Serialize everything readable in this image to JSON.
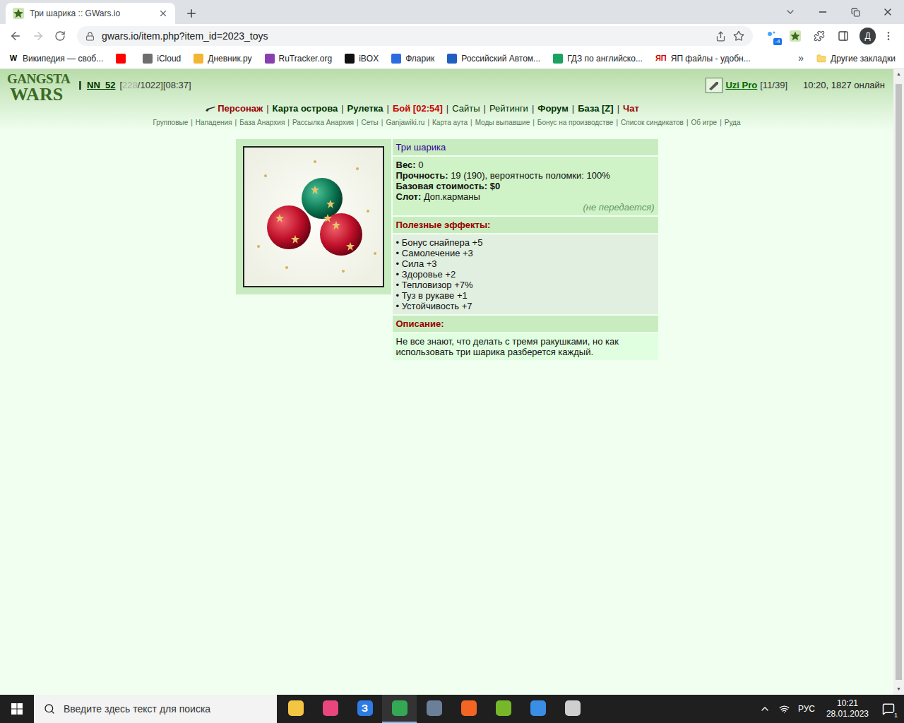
{
  "browser": {
    "tabs": [
      {
        "title": "Три шарика :: GWars.io",
        "selected": true
      }
    ],
    "url": "gwars.io/item.php?item_id=2023_toys",
    "extension_badge": "-4",
    "profile": "Д"
  },
  "bookmarks": [
    {
      "label": "Википедия — своб...",
      "icon_text": "W",
      "color": "#000000"
    },
    {
      "label": "",
      "icon_text": "",
      "color": "#ff0000"
    },
    {
      "label": "iCloud",
      "icon_text": "",
      "color": "#6e6e6e"
    },
    {
      "label": "Дневник.ру",
      "icon_text": "",
      "color": "#f2b632"
    },
    {
      "label": "RuTracker.org",
      "icon_text": "",
      "color": "#8a3fb0"
    },
    {
      "label": "iBOX",
      "icon_text": "",
      "color": "#111111"
    },
    {
      "label": "Фларик",
      "icon_text": "",
      "color": "#2d6cdf"
    },
    {
      "label": "Российский Автом...",
      "icon_text": "",
      "color": "#1f5fbf"
    },
    {
      "label": "ГДЗ по английско...",
      "icon_text": "",
      "color": "#1aa260"
    },
    {
      "label": "ЯП файлы - удобн...",
      "icon_text": "ЯП",
      "color": "#d40000"
    }
  ],
  "bookmarks_more": "»",
  "other_bookmarks": "Другие закладки",
  "game": {
    "logo": [
      "GANGSTA",
      "WARS"
    ],
    "player": {
      "name": "NN_52",
      "open": "[",
      "hp": "228",
      "rest": "/1022][08:37]"
    },
    "weapon": {
      "name": "Uzi Pro",
      "ammo": "[11/39]"
    },
    "online": "10:20, 1827 онлайн",
    "separator": "|",
    "menu": [
      {
        "label": "Персонаж",
        "color": "#990000",
        "bold": true
      },
      {
        "label": "Карта острова",
        "color": "#003300",
        "bold": true
      },
      {
        "label": "Рулетка",
        "color": "#003300",
        "bold": true
      },
      {
        "label": "Бой [02:54]",
        "color": "#cc0000",
        "bold": true
      },
      {
        "label": "Сайты",
        "color": "#003300",
        "bold": false
      },
      {
        "label": "Рейтинги",
        "color": "#003300",
        "bold": false
      },
      {
        "label": "Форум",
        "color": "#003300",
        "bold": true
      },
      {
        "label": "База [Z]",
        "color": "#003300",
        "bold": true
      },
      {
        "label": "Чат",
        "color": "#990000",
        "bold": true
      }
    ],
    "submenu": [
      "Групповые",
      "Нападения",
      "База Анархия",
      "Рассылка Анархия",
      "Сеты",
      "Ganjawiki.ru",
      "Карта аута",
      "Моды выпавшие",
      "Бонус на производстве",
      "Список синдикатов",
      "Об игре",
      "Руда"
    ]
  },
  "item": {
    "title": "Три шарика",
    "properties": [
      {
        "label": "Вес:",
        "value": "0",
        "bold_value": false
      },
      {
        "label": "Прочность:",
        "value": "19 (190), вероятность поломки: 100%",
        "bold_value": false
      },
      {
        "label": "Базовая стоимость:",
        "value": "$0",
        "bold_value": true
      },
      {
        "label": "Слот:",
        "value": "Доп.карманы",
        "bold_value": false
      }
    ],
    "note": "(не передается)",
    "effects_title": "Полезные эффекты:",
    "bullet": "•",
    "effects": [
      "Бонус снайпера +5",
      "Самолечение +3",
      "Сила +3",
      "Здоровье +2",
      "Тепловизор +7%",
      "Туз в рукаве +1",
      "Устойчивость +7"
    ],
    "description_title": "Описание:",
    "description": "Не все знают, что делать с тремя ракушками, но как использовать три шарика разберется каждый."
  },
  "taskbar": {
    "search_placeholder": "Введите здесь текст для поиска",
    "apps": [
      {
        "color": "#f4c542",
        "glyph": "",
        "active": false
      },
      {
        "color": "#e8467c",
        "glyph": "",
        "active": false
      },
      {
        "color": "#2d7be5",
        "glyph": "З",
        "active": false
      },
      {
        "color": "#34a853",
        "glyph": "",
        "active": true
      },
      {
        "color": "#6b7f99",
        "glyph": "",
        "active": false
      },
      {
        "color": "#f26522",
        "glyph": "",
        "active": false
      },
      {
        "color": "#76b82a",
        "glyph": "",
        "active": false
      },
      {
        "color": "#3a8ee6",
        "glyph": "",
        "active": false
      },
      {
        "color": "#cfcfcf",
        "glyph": "",
        "active": false
      }
    ],
    "language": "РУС",
    "time": "10:21",
    "date": "28.01.2023",
    "notifications": "1"
  }
}
